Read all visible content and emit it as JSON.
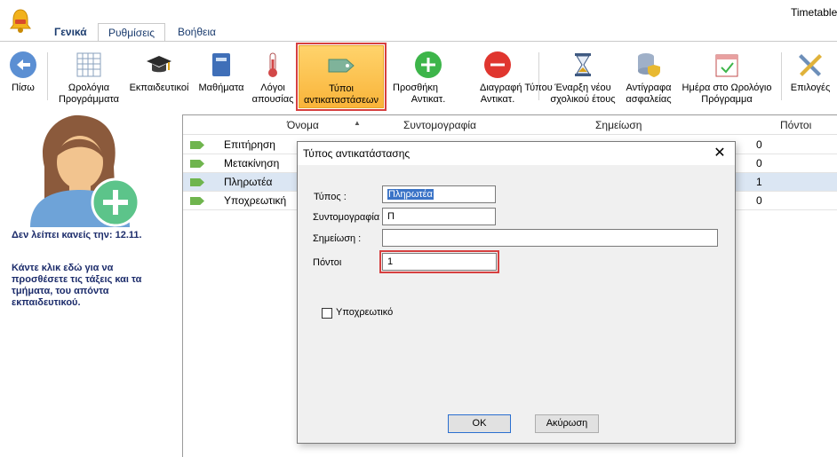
{
  "window": {
    "title": "Timetable"
  },
  "tabs": [
    {
      "label": "Γενικά"
    },
    {
      "label": "Ρυθμίσεις"
    },
    {
      "label": "Βοήθεια"
    }
  ],
  "ribbon": {
    "back": "Πίσω",
    "timetables": [
      "Ωρολόγια",
      "Προγράμματα"
    ],
    "teachers": "Εκπαιδευτικοί",
    "subjects": "Μαθήματα",
    "absence_reasons": [
      "Λόγοι",
      "απουσίας"
    ],
    "substitution_types": [
      "Τύποι",
      "αντικαταστάσεων"
    ],
    "add_type": [
      "Προσθήκη",
      "Αντικατ."
    ],
    "delete_type": [
      "Τύποι",
      "Διαγραφή Τύπου",
      "Αντικατ."
    ],
    "new_year": [
      "Έναρξη νέου",
      "σχολικού έτους"
    ],
    "backup": [
      "Αντίγραφα",
      "ασφαλείας"
    ],
    "day_in_timetable": [
      "Ημέρα στο Ωρολόγιο",
      "Πρόγραμμα"
    ],
    "options": "Επιλογές"
  },
  "left_panel": {
    "missing": "Δεν λείπει κανείς την: 12.11.",
    "hint": "Κάντε κλικ εδώ για να προσθέσετε τις τάξεις και τα τμήματα, του απόντα εκπαιδευτικού."
  },
  "grid": {
    "columns": [
      "Όνομα",
      "Συντομογραφία",
      "Σημείωση",
      "Πόντοι"
    ],
    "rows": [
      {
        "name": "Επιτήρηση",
        "points": "0"
      },
      {
        "name": "Μετακίνηση",
        "points": "0"
      },
      {
        "name": "Πληρωτέα",
        "points": "1"
      },
      {
        "name": "Υποχρεωτική",
        "points": "0"
      }
    ]
  },
  "dialog": {
    "title": "Τύπος αντικατάστασης",
    "type_label": "Τύπος :",
    "type_value": "Πληρωτέα",
    "abbr_label": "Συντομογραφία",
    "abbr_value": "Π",
    "note_label": "Σημείωση :",
    "note_value": "",
    "points_label": "Πόντοι",
    "points_value": "1",
    "mandatory_label": "Υποχρεωτικό",
    "ok": "OK",
    "cancel": "Ακύρωση"
  },
  "colors": {
    "accent_highlight": "#d64040",
    "ribbon_selected": "#f9b43a",
    "tag_green": "#6fb54e",
    "dark_label": "#1c2c6b"
  }
}
